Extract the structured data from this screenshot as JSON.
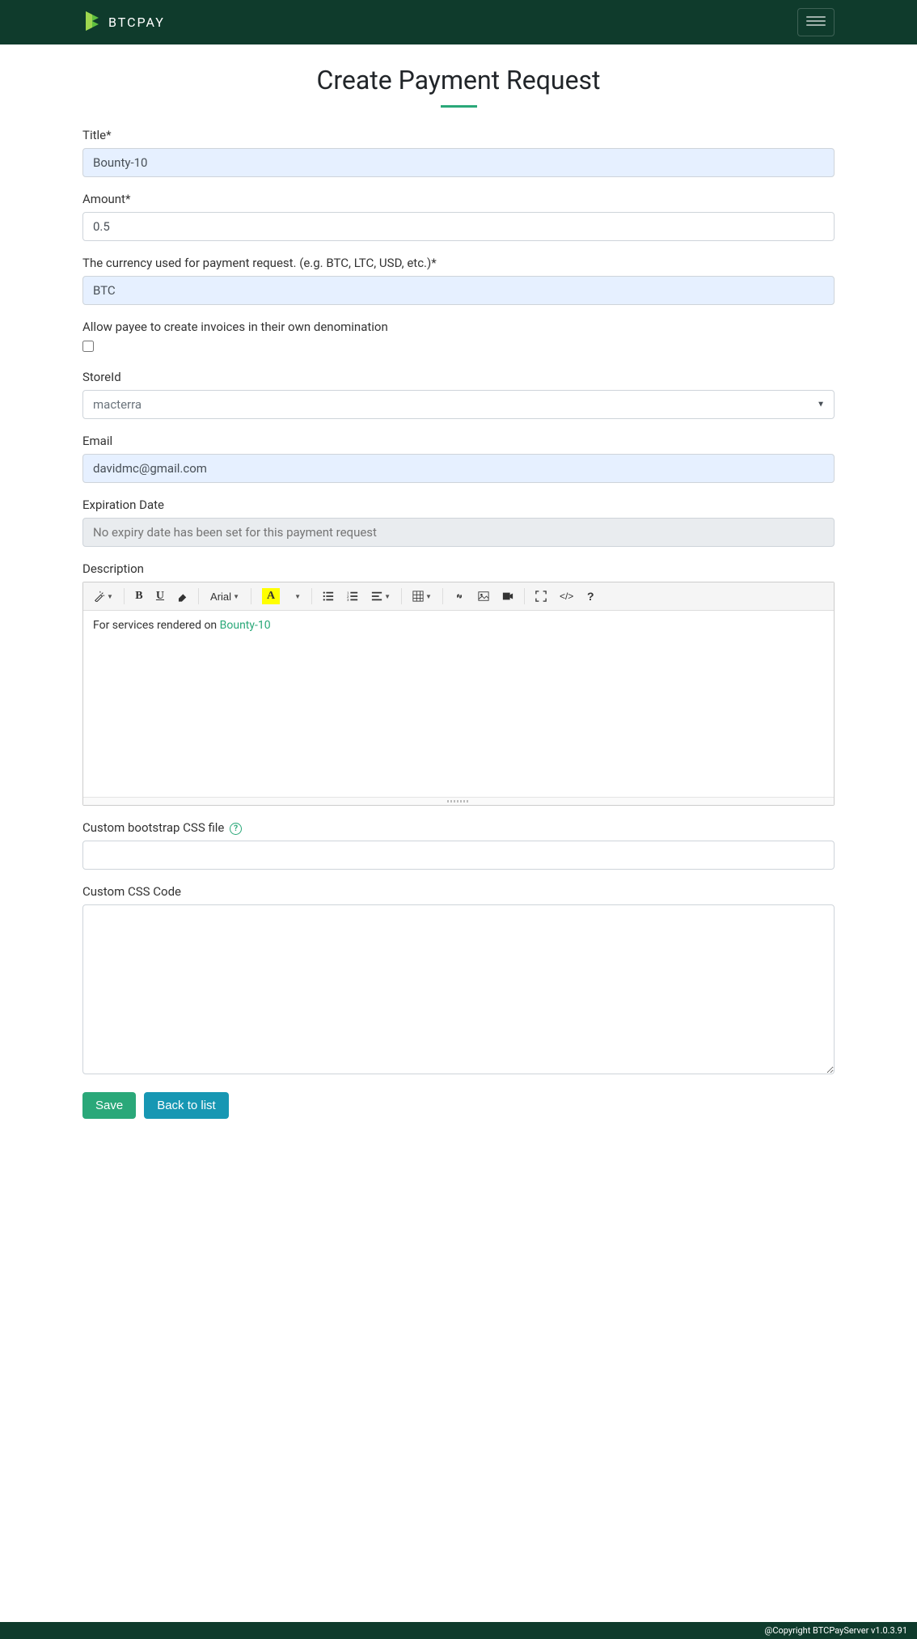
{
  "brand": {
    "name": "BTCPAY"
  },
  "page": {
    "title": "Create Payment Request"
  },
  "form": {
    "title": {
      "label": "Title*",
      "value": "Bounty-10"
    },
    "amount": {
      "label": "Amount*",
      "value": "0.5"
    },
    "currency": {
      "label": "The currency used for payment request. (e.g. BTC, LTC, USD, etc.)*",
      "value": "BTC"
    },
    "allow_payee": {
      "label": "Allow payee to create invoices in their own denomination",
      "checked": false
    },
    "store": {
      "label": "StoreId",
      "value": "macterra"
    },
    "email": {
      "label": "Email",
      "value": "davidmc@gmail.com"
    },
    "expiration": {
      "label": "Expiration Date",
      "placeholder": "No expiry date has been set for this payment request"
    },
    "description": {
      "label": "Description",
      "text_prefix": "For services rendered on ",
      "link_text": "Bounty-10"
    },
    "custom_css_file": {
      "label": "Custom bootstrap CSS file",
      "value": ""
    },
    "custom_css_code": {
      "label": "Custom CSS Code",
      "value": ""
    }
  },
  "toolbar": {
    "font": "Arial"
  },
  "buttons": {
    "save": "Save",
    "back": "Back to list"
  },
  "footer": {
    "copyright": "@Copyright BTCPayServer v1.0.3.91"
  }
}
